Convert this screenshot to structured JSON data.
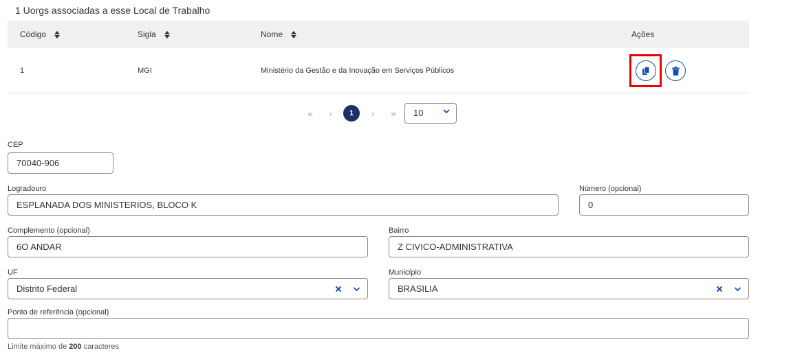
{
  "section_title": "1 Uorgs associadas a esse Local de Trabalho",
  "table": {
    "columns": [
      "Código",
      "Sigla",
      "Nome",
      "Ações"
    ],
    "rows": [
      {
        "codigo": "1",
        "sigla": "MGI",
        "nome": "Ministério da Gestão e da Inovação em Serviços Públicos"
      }
    ],
    "action_icons": [
      "copy-icon",
      "trash-icon"
    ]
  },
  "pagination": {
    "first": "«",
    "prev": "‹",
    "current": "1",
    "next": "›",
    "last": "»",
    "page_size": "10"
  },
  "form": {
    "cep": {
      "label": "CEP",
      "value": "70040-906"
    },
    "logradouro": {
      "label": "Logradouro",
      "value": "ESPLANADA DOS MINISTERIOS, BLOCO K"
    },
    "numero": {
      "label": "Número (opcional)",
      "value": "0"
    },
    "complemento": {
      "label": "Complemento (opcional)",
      "value": "6O ANDAR"
    },
    "bairro": {
      "label": "Bairro",
      "value": "Z CIVICO-ADMINISTRATIVA"
    },
    "uf": {
      "label": "UF",
      "value": "Distrito Federal"
    },
    "municipio": {
      "label": "Município",
      "value": "BRASILIA"
    },
    "ponto_referencia": {
      "label": "Ponto de referência (opcional)",
      "value": ""
    },
    "hint_prefix": "Limite máximo de",
    "hint_number": "200",
    "hint_suffix": "caracteres"
  },
  "colors": {
    "primary": "#1351b4",
    "active_page": "#1b2f6b",
    "highlight": "#e60000"
  }
}
